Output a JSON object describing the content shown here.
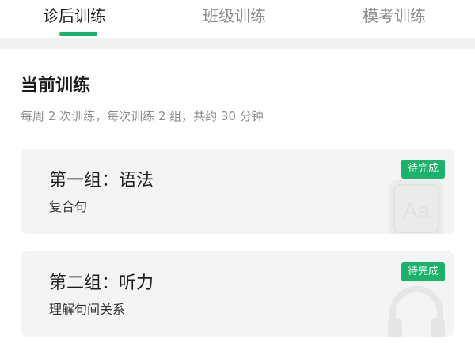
{
  "tabs": [
    {
      "label": "诊后训练",
      "active": true
    },
    {
      "label": "班级训练",
      "active": false
    },
    {
      "label": "模考训练",
      "active": false
    }
  ],
  "section": {
    "title": "当前训练",
    "subtitle": "每周 2 次训练，每次训练 2 组，共约 30 分钟"
  },
  "cards": [
    {
      "title": "第一组：语法",
      "subtitle": "复合句",
      "badge": "待完成",
      "watermark_icon": "grammar-aa-icon"
    },
    {
      "title": "第二组：听力",
      "subtitle": "理解句间关系",
      "badge": "待完成",
      "watermark_icon": "headphones-icon"
    }
  ],
  "colors": {
    "accent": "#1ab36b",
    "card_bg": "#f4f4f4",
    "separator": "#f1f1f1"
  }
}
